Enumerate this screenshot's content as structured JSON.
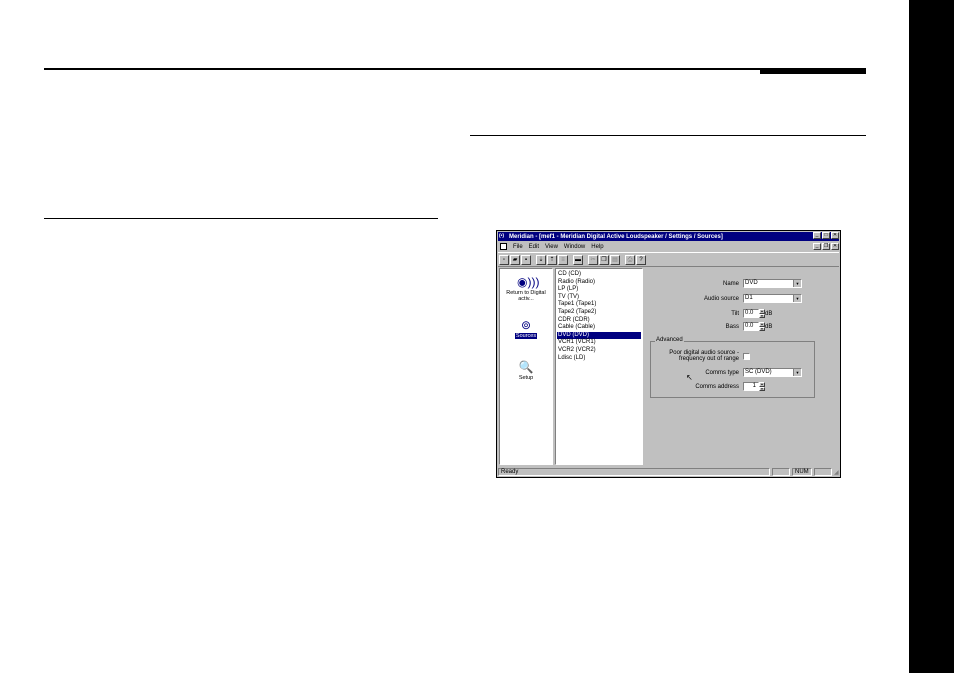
{
  "window": {
    "title": "Meridian - [mef1 - Meridian Digital Active Loudspeaker / Settings / Sources]",
    "title_icon": "(•)",
    "buttons": [
      "_",
      "□",
      "✕"
    ],
    "mdi_buttons": [
      "_",
      "❐",
      "✕"
    ]
  },
  "menu": {
    "items": [
      "File",
      "Edit",
      "View",
      "Window",
      "Help"
    ]
  },
  "toolbar": {
    "buttons": [
      "new-icon",
      "open-icon",
      "save-icon",
      "download-icon",
      "upload-icon",
      "compare-icon",
      "send-icon",
      "cut-icon",
      "copy-icon",
      "paste-icon",
      "print-icon",
      "help-icon"
    ]
  },
  "nav": {
    "items": [
      {
        "label": "Return to Digital activ...",
        "icon": "speaker-icon"
      },
      {
        "label": "Sources",
        "icon": "sources-icon",
        "selected": true
      },
      {
        "label": "Setup",
        "icon": "magnifier-icon"
      }
    ]
  },
  "sources": {
    "items": [
      "CD (CD)",
      "Radio (Radio)",
      "LP (LP)",
      "TV (TV)",
      "Tape1 (Tape1)",
      "Tape2 (Tape2)",
      "CDR (CDR)",
      "Cable (Cable)",
      "DVD (DVD)",
      "VCR1 (VCR1)",
      "VCR2 (VCR2)",
      "Ldisc (LD)"
    ],
    "selected": "DVD (DVD)"
  },
  "form": {
    "name_label": "Name",
    "name_value": "DVD",
    "audio_source_label": "Audio source",
    "audio_source_value": "D1",
    "tilt_label": "Tilt",
    "tilt_value": "0.0",
    "tilt_unit": "dB",
    "bass_label": "Bass",
    "bass_value": "0.0",
    "bass_unit": "dB",
    "advanced_label": "Advanced",
    "poor_digital_label_1": "Poor digital audio source -",
    "poor_digital_label_2": "frequency out of range",
    "comms_type_label": "Comms type",
    "comms_type_value": "SC (DVD)",
    "comms_address_label": "Comms address",
    "comms_address_value": "1"
  },
  "status": {
    "text": "Ready",
    "num": "NUM"
  }
}
